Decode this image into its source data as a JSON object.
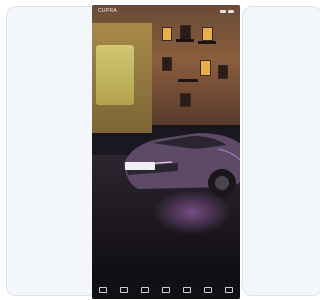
{
  "app": {
    "brand": "CUPRA"
  },
  "hero": {
    "headline": "",
    "cta_label": ""
  },
  "bottom_nav": {
    "items": [
      {
        "label": ""
      },
      {
        "label": ""
      },
      {
        "label": ""
      },
      {
        "label": ""
      },
      {
        "label": ""
      },
      {
        "label": ""
      },
      {
        "label": ""
      }
    ]
  },
  "colors": {
    "accent": "#b57ad1",
    "background": "#f3f6fa"
  }
}
